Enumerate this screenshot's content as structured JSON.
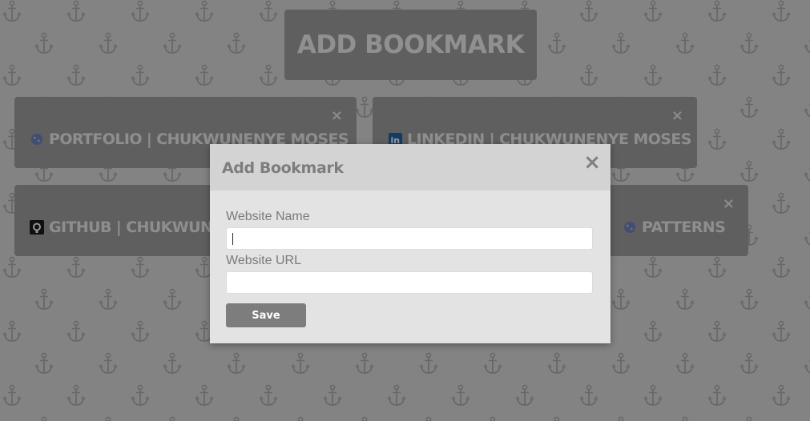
{
  "header": {
    "add_bookmark_label": "ADD BOOKMARK"
  },
  "bookmarks": [
    {
      "label": "PORTFOLIO | CHUKWUNENYE MOSES",
      "icon": "globe-icon",
      "close": "×"
    },
    {
      "label": "LINKEDIN | CHUKWUNENYE MOSES",
      "icon": "linkedin-icon",
      "close": "×"
    },
    {
      "label": "GITHUB | CHUKWUNENYE MOSES",
      "icon": "github-icon",
      "close": "×"
    },
    {
      "label": "PATTERNS",
      "icon": "globe-icon",
      "close": "×"
    }
  ],
  "modal": {
    "title": "Add Bookmark",
    "close": "×",
    "name_label": "Website Name",
    "name_value": "",
    "url_label": "Website URL",
    "url_value": "",
    "save_label": "Save"
  },
  "colors": {
    "page_background": "#d4d4d4",
    "card": "#9a9a9a",
    "modal_header": "#d3d3d3",
    "modal_body": "#e3e3e3",
    "save_button": "#7d7d7d"
  },
  "background_pattern_icon": "anchor-icon"
}
